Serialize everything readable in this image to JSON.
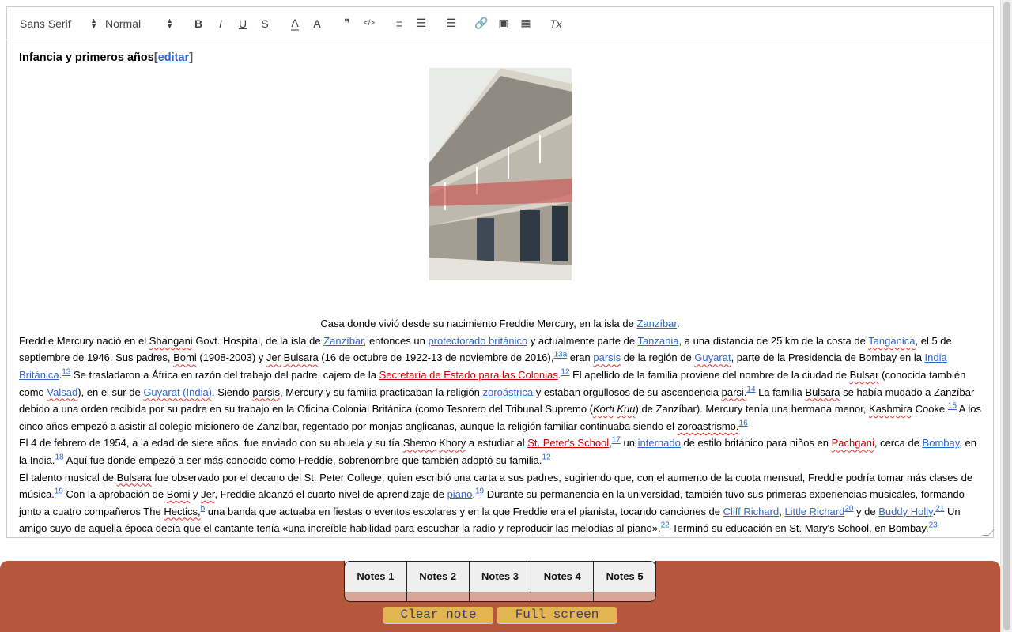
{
  "toolbar": {
    "font": "Sans Serif",
    "size": "Normal",
    "buttons": [
      {
        "name": "bold",
        "g": "B"
      },
      {
        "name": "italic",
        "g": "I"
      },
      {
        "name": "underline",
        "g": "U"
      },
      {
        "name": "strike",
        "g": "S"
      },
      {
        "name": "text-color",
        "g": "A"
      },
      {
        "name": "background-color",
        "g": "A"
      },
      {
        "name": "blockquote",
        "g": "❞"
      },
      {
        "name": "code",
        "g": "</>"
      },
      {
        "name": "ordered-list",
        "g": "≡"
      },
      {
        "name": "bullet-list",
        "g": "☰"
      },
      {
        "name": "align",
        "g": "☰"
      },
      {
        "name": "link",
        "g": "🔗"
      },
      {
        "name": "image",
        "g": "▣"
      },
      {
        "name": "video",
        "g": "▦"
      },
      {
        "name": "clean",
        "g": "Tx"
      }
    ]
  },
  "content": {
    "heading": "Infancia y primeros años",
    "edit_open": "[",
    "edit_link": "editar",
    "edit_close": "]",
    "caption": [
      {
        "t": "Casa donde vivió desde su nacimiento Freddie Mercury, en la isla de "
      },
      {
        "t": "Zanzíbar",
        "l": 1
      },
      {
        "t": "."
      }
    ],
    "paragraphs": [
      [
        {
          "t": "Freddie Mercury nació en el "
        },
        {
          "t": "Shangani",
          "s": 1
        },
        {
          "t": " Govt. Hospital, de la isla de "
        },
        {
          "t": "Zanzíbar",
          "l": 1
        },
        {
          "t": ", entonces un "
        },
        {
          "t": "protectorado británico",
          "l": 1
        },
        {
          "t": " y actualmente parte de "
        },
        {
          "t": "Tanzania",
          "l": 1
        },
        {
          "t": ", a una distancia de 25 km de la costa de "
        },
        {
          "t": "Tanganica",
          "l": 1,
          "s": 1
        },
        {
          "t": ", el 5 de septiembre de 1946. Sus padres, "
        },
        {
          "t": "Bomi",
          "s": 1
        },
        {
          "t": " (1908-2003) y "
        },
        {
          "t": "Jer",
          "s": 1
        },
        {
          "t": " "
        },
        {
          "t": "Bulsara",
          "s": 1
        },
        {
          "t": " (16 de octubre de 1922-13 de noviembre de 2016),"
        },
        {
          "t": "13a",
          "sup": 1
        },
        {
          "t": " eran "
        },
        {
          "t": "parsis",
          "l": 1,
          "s": 1
        },
        {
          "t": " de la región de "
        },
        {
          "t": "Guyarat",
          "l": 1,
          "s": 1
        },
        {
          "t": ", parte de la Presidencia de Bombay en la "
        },
        {
          "t": "India Británica",
          "l": 1
        },
        {
          "t": "."
        },
        {
          "t": "13",
          "sup": 1
        },
        {
          "t": " Se trasladaron a África en razón del trabajo del padre, cajero de la "
        },
        {
          "t": "Secretaría de Estado para las Colonias",
          "l": 1,
          "r": 1
        },
        {
          "t": "."
        },
        {
          "t": "12",
          "sup": 1
        },
        {
          "t": " El apellido de la familia proviene del nombre de la ciudad de "
        },
        {
          "t": "Bulsar",
          "s": 1
        },
        {
          "t": " (conocida también como "
        },
        {
          "t": "Valsad",
          "l": 1,
          "s": 1
        },
        {
          "t": "), en el sur de "
        },
        {
          "t": "Guyarat (India)",
          "l": 1,
          "s": 1
        },
        {
          "t": ". Siendo "
        },
        {
          "t": "parsis",
          "s": 1
        },
        {
          "t": ", Mercury y su familia practicaban la religión "
        },
        {
          "t": "zoroástrica",
          "l": 1
        },
        {
          "t": " y estaban orgullosos de su ascendencia "
        },
        {
          "t": "parsi.",
          "s": 1
        },
        {
          "t": "14",
          "sup": 1
        },
        {
          "t": " La familia "
        },
        {
          "t": "Bulsara",
          "s": 1
        },
        {
          "t": " se había mudado a Zanzíbar debido a una orden recibida por su padre en su trabajo en la Oficina Colonial Británica (como Tesorero del Tribunal Supremo ("
        },
        {
          "t": "Korti",
          "s": 1,
          "i": 1
        },
        {
          "t": " "
        },
        {
          "t": "Kuu",
          "s": 1,
          "i": 1
        },
        {
          "t": ") de Zanzíbar). Mercury tenía una hermana menor, "
        },
        {
          "t": "Kashmira",
          "s": 1
        },
        {
          "t": " Cooke."
        },
        {
          "t": "15",
          "sup": 1
        },
        {
          "t": " A los cinco años empezó a asistir al colegio misionero de Zanzíbar, regentado por monjas anglicanas, aunque la religión familiar continuaba siendo el "
        },
        {
          "t": "zoroastrismo.",
          "s": 1
        },
        {
          "t": "16",
          "sup": 1
        }
      ],
      [
        {
          "t": "El 4 de febrero de 1954, a la edad de siete años, fue enviado con su abuela y su tía "
        },
        {
          "t": "Sheroo",
          "s": 1
        },
        {
          "t": " "
        },
        {
          "t": "Khory",
          "s": 1
        },
        {
          "t": " a estudiar al "
        },
        {
          "t": "St. Peter's School",
          "l": 1,
          "r": 1
        },
        {
          "t": ","
        },
        {
          "t": "17",
          "sup": 1
        },
        {
          "t": " un "
        },
        {
          "t": "internado",
          "l": 1
        },
        {
          "t": " de estilo británico para niños en "
        },
        {
          "t": "Pachgani",
          "l": 1,
          "r": 1,
          "s": 1
        },
        {
          "t": ", cerca de "
        },
        {
          "t": "Bombay",
          "l": 1
        },
        {
          "t": ", en la India."
        },
        {
          "t": "18",
          "sup": 1
        },
        {
          "t": " Aquí fue donde empezó a ser más conocido como Freddie, sobrenombre que también adoptó su familia."
        },
        {
          "t": "12",
          "sup": 1
        }
      ],
      [
        {
          "t": "El talento musical de "
        },
        {
          "t": "Bulsara",
          "s": 1
        },
        {
          "t": " fue observado por el decano del St. Peter College, quien escribió una carta a sus padres, sugiriendo que, con el aumento de la cuota mensual, Freddie podría tomar más clases de música."
        },
        {
          "t": "19",
          "sup": 1
        },
        {
          "t": " Con la aprobación de "
        },
        {
          "t": "Bomi",
          "s": 1
        },
        {
          "t": " y "
        },
        {
          "t": "Jer",
          "s": 1
        },
        {
          "t": ", Freddie alcanzó el cuarto nivel de aprendizaje de "
        },
        {
          "t": "piano",
          "l": 1
        },
        {
          "t": "."
        },
        {
          "t": "19",
          "sup": 1
        },
        {
          "t": " Durante su permanencia en la universidad, también tuvo sus primeras experiencias musicales, formando junto a cuatro compañeros The "
        },
        {
          "t": "Hectics,",
          "s": 1
        },
        {
          "t": "b",
          "sup": 1
        },
        {
          "t": " una banda que actuaba en fiestas o eventos escolares y en la que Freddie era el pianista, tocando canciones de "
        },
        {
          "t": "Cliff Richard",
          "l": 1
        },
        {
          "t": ", "
        },
        {
          "t": "Little Richard",
          "l": 1
        },
        {
          "t": "20",
          "sup": 1
        },
        {
          "t": " y de "
        },
        {
          "t": "Buddy Holly",
          "l": 1
        },
        {
          "t": "."
        },
        {
          "t": "21",
          "sup": 1
        },
        {
          "t": " Un amigo suyo de aquella época decía que el cantante tenía «una increíble habilidad para escuchar la radio y reproducir las melodías al piano»."
        },
        {
          "t": "22",
          "sup": 1
        },
        {
          "t": " Terminó su educación en St. Mary's School, en Bombay."
        },
        {
          "t": "23",
          "sup": 1
        }
      ]
    ]
  },
  "notes": {
    "tabs": [
      "Notes 1",
      "Notes 2",
      "Notes 3",
      "Notes 4",
      "Notes 5"
    ],
    "clear": "Clear note",
    "fullscreen": "Full screen"
  },
  "colors": {
    "panel": "#b5573a",
    "button": "#e3b550",
    "link": "#3366cc",
    "redlink": "#cc0000"
  }
}
